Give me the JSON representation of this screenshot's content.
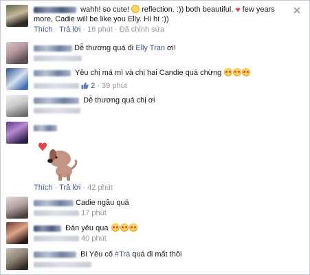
{
  "actions": {
    "like": "Thích",
    "reply": "Trả lời",
    "separator": "·"
  },
  "comments": [
    {
      "text_parts": [
        "wahh! so cute! ",
        " reflection. :)) both beautiful. ",
        " few years more, Cadie will be like you Elly. Hí hí :))"
      ],
      "time": "18 phút",
      "edited": "Đã chỉnh sửa"
    },
    {
      "text": "Dễ thương quá đi ",
      "mention": "Elly Tran",
      "text_after": " ơi!"
    },
    {
      "text": "Yêu chị má mì và chị hai Candie quá chừng ",
      "likes": "2",
      "time": "39 phút"
    },
    {
      "text": "Dễ thương quá chị ơi"
    },
    {
      "time": "42 phút"
    },
    {
      "text": "Cadie ngầu quá",
      "time": "17 phút"
    },
    {
      "text": "Đán yêu qua ",
      "time": "40 phút"
    },
    {
      "text_before": "Bi Yêu cố ",
      "hashtag": "#Trà",
      "text_after": " quá đi mất thôi"
    }
  ],
  "icons": {
    "close": "close-icon",
    "like": "like-thumb-icon",
    "heart": "heart-emoticon",
    "smile": "smile-emoticon",
    "hearteyes": "heart-eyes-emoticon",
    "sticker": "puppy-heart-sticker"
  },
  "colors": {
    "link": "#3b5998",
    "meta": "#9197a3",
    "text": "#141823",
    "heart": "#e0474f"
  }
}
